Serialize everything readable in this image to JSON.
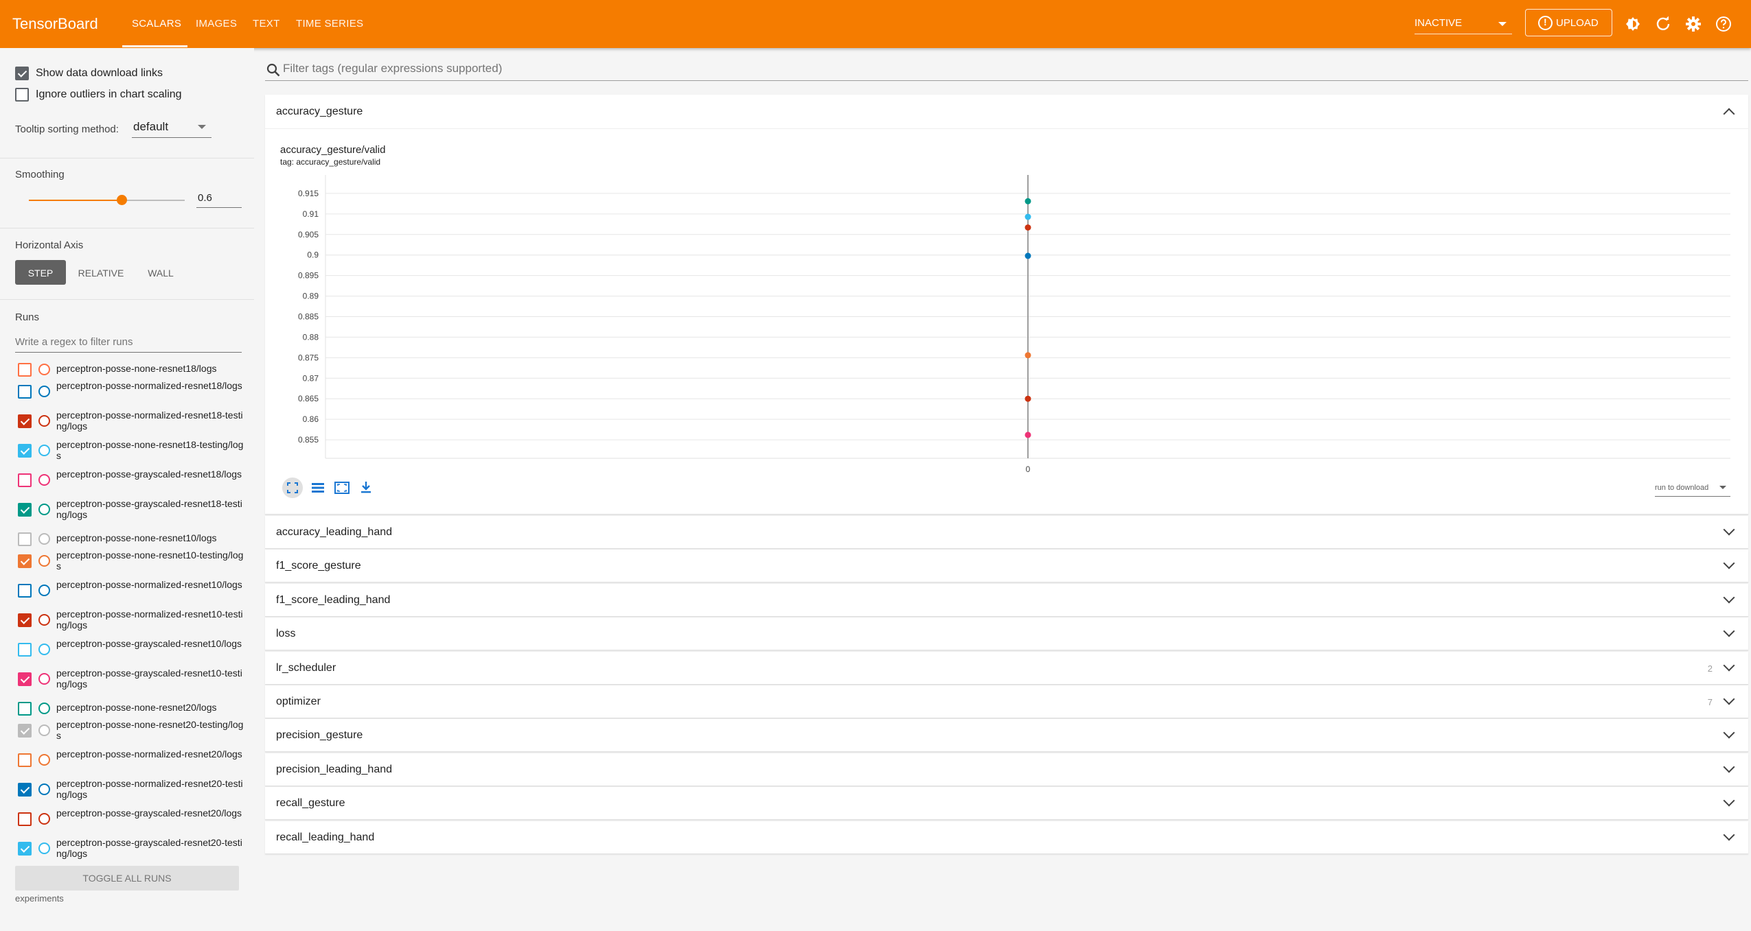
{
  "app": {
    "title": "TensorBoard",
    "tabs": [
      {
        "label": "SCALARS",
        "active": true
      },
      {
        "label": "IMAGES",
        "active": false
      },
      {
        "label": "TEXT",
        "active": false
      },
      {
        "label": "TIME SERIES",
        "active": false
      }
    ],
    "status": "INACTIVE",
    "upload_label": "UPLOAD",
    "icons": [
      "brightness-icon",
      "refresh-icon",
      "settings-icon",
      "help-icon"
    ]
  },
  "colors": {
    "accent": "#f57c00"
  },
  "sidebar": {
    "show_download_links": {
      "label": "Show data download links",
      "checked": true
    },
    "ignore_outliers": {
      "label": "Ignore outliers in chart scaling",
      "checked": false
    },
    "tooltip_label": "Tooltip sorting method:",
    "tooltip_value": "default",
    "smoothing_label": "Smoothing",
    "smoothing_value": "0.6",
    "smoothing_level": 0.6,
    "horizontal_axis_label": "Horizontal Axis",
    "axis_options": [
      "STEP",
      "RELATIVE",
      "WALL"
    ],
    "axis_selected": "STEP",
    "runs_label": "Runs",
    "runs_filter_placeholder": "Write a regex to filter runs",
    "runs": [
      {
        "name": "perceptron-posse-none-resnet18/logs",
        "color": "#ff7043",
        "checked": false
      },
      {
        "name": "perceptron-posse-normalized-resnet18/logs",
        "color": "#0077bb",
        "checked": false
      },
      {
        "name": "perceptron-posse-normalized-resnet18-testing/logs",
        "color": "#cc3311",
        "checked": true
      },
      {
        "name": "perceptron-posse-none-resnet18-testing/logs",
        "color": "#33bbee",
        "checked": true
      },
      {
        "name": "perceptron-posse-grayscaled-resnet18/logs",
        "color": "#ee3377",
        "checked": false
      },
      {
        "name": "perceptron-posse-grayscaled-resnet18-testing/logs",
        "color": "#009988",
        "checked": true
      },
      {
        "name": "perceptron-posse-none-resnet10/logs",
        "color": "#bbbbbb",
        "checked": false
      },
      {
        "name": "perceptron-posse-none-resnet10-testing/logs",
        "color": "#ee7733",
        "checked": true
      },
      {
        "name": "perceptron-posse-normalized-resnet10/logs",
        "color": "#0077bb",
        "checked": false
      },
      {
        "name": "perceptron-posse-normalized-resnet10-testing/logs",
        "color": "#cc3311",
        "checked": true
      },
      {
        "name": "perceptron-posse-grayscaled-resnet10/logs",
        "color": "#33bbee",
        "checked": false
      },
      {
        "name": "perceptron-posse-grayscaled-resnet10-testing/logs",
        "color": "#ee3377",
        "checked": true
      },
      {
        "name": "perceptron-posse-none-resnet20/logs",
        "color": "#009988",
        "checked": false
      },
      {
        "name": "perceptron-posse-none-resnet20-testing/logs",
        "color": "#bbbbbb",
        "checked": true
      },
      {
        "name": "perceptron-posse-normalized-resnet20/logs",
        "color": "#ee7733",
        "checked": false
      },
      {
        "name": "perceptron-posse-normalized-resnet20-testing/logs",
        "color": "#0077bb",
        "checked": true
      },
      {
        "name": "perceptron-posse-grayscaled-resnet20/logs",
        "color": "#cc3311",
        "checked": false
      },
      {
        "name": "perceptron-posse-grayscaled-resnet20-testing/logs",
        "color": "#33bbee",
        "checked": true
      }
    ],
    "toggle_all_label": "TOGGLE ALL RUNS",
    "footer": "experiments"
  },
  "main": {
    "filter_placeholder": "Filter tags (regular expressions supported)",
    "expanded_section": "accuracy_gesture",
    "chart": {
      "title": "accuracy_gesture/valid",
      "tag": "tag: accuracy_gesture/valid",
      "run_download_label": "run to download"
    },
    "sections": [
      {
        "name": "accuracy_leading_hand",
        "count": ""
      },
      {
        "name": "f1_score_gesture",
        "count": ""
      },
      {
        "name": "f1_score_leading_hand",
        "count": ""
      },
      {
        "name": "loss",
        "count": ""
      },
      {
        "name": "lr_scheduler",
        "count": "2"
      },
      {
        "name": "optimizer",
        "count": "7"
      },
      {
        "name": "precision_gesture",
        "count": ""
      },
      {
        "name": "precision_leading_hand",
        "count": ""
      },
      {
        "name": "recall_gesture",
        "count": ""
      },
      {
        "name": "recall_leading_hand",
        "count": ""
      }
    ]
  },
  "chart_data": {
    "type": "scatter",
    "title": "accuracy_gesture/valid",
    "xlabel": "",
    "ylabel": "",
    "x_ticks": [
      "0"
    ],
    "y_ticks": [
      "0.915",
      "0.91",
      "0.905",
      "0.9",
      "0.895",
      "0.89",
      "0.885",
      "0.88",
      "0.875",
      "0.87",
      "0.865",
      "0.86",
      "0.855"
    ],
    "ylim": [
      0.8505,
      0.9195
    ],
    "grid": true,
    "series": [
      {
        "color": "#009988",
        "x": [
          0
        ],
        "y": [
          0.9131
        ]
      },
      {
        "color": "#33bbee",
        "x": [
          0
        ],
        "y": [
          0.9093
        ]
      },
      {
        "color": "#cc3311",
        "x": [
          0
        ],
        "y": [
          0.9067
        ]
      },
      {
        "color": "#0077bb",
        "x": [
          0
        ],
        "y": [
          0.8998
        ]
      },
      {
        "color": "#ee7733",
        "x": [
          0
        ],
        "y": [
          0.8756
        ]
      },
      {
        "color": "#cc3311",
        "x": [
          0
        ],
        "y": [
          0.865
        ]
      },
      {
        "color": "#ee3377",
        "x": [
          0
        ],
        "y": [
          0.8562
        ]
      }
    ]
  }
}
